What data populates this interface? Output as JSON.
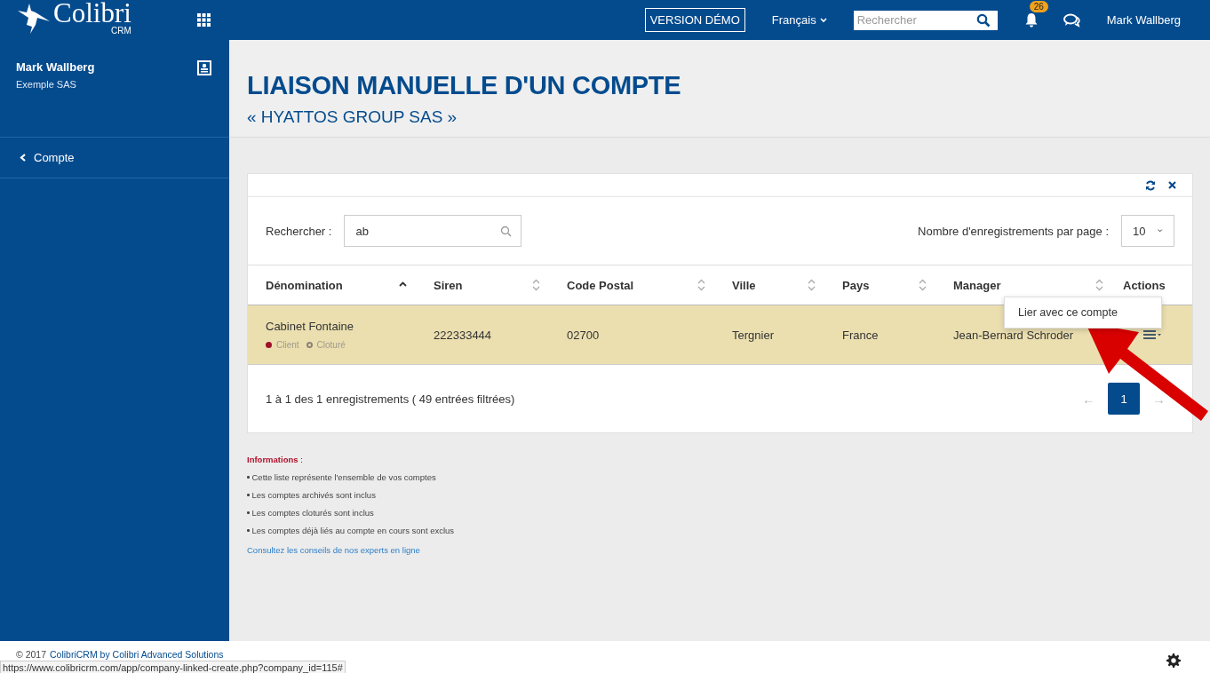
{
  "header": {
    "logo": "Colibri",
    "logo_sub": "CRM",
    "demo_button": "VERSION DÉMO",
    "language": "Français",
    "search": {
      "placeholder": "Rechercher"
    },
    "notifications": "26",
    "user": "Mark Wallberg"
  },
  "sidebar": {
    "user_name": "Mark Wallberg",
    "company": "Exemple SAS",
    "items": [
      {
        "label": "Compte"
      }
    ]
  },
  "page": {
    "title": "LIAISON MANUELLE D'UN COMPTE",
    "subtitle": "« HYATTOS GROUP SAS »"
  },
  "table_panel": {
    "search_label": "Rechercher :",
    "search_value": "ab",
    "page_size_label": "Nombre d'enregistrements par page :",
    "page_size": "10",
    "columns": [
      {
        "label": "Dénomination",
        "sortable": true,
        "sorted": true
      },
      {
        "label": "Siren",
        "sortable": true,
        "sorted": false
      },
      {
        "label": "Code Postal",
        "sortable": true,
        "sorted": false
      },
      {
        "label": "Ville",
        "sortable": true,
        "sorted": false
      },
      {
        "label": "Pays",
        "sortable": true,
        "sorted": false
      },
      {
        "label": "Manager",
        "sortable": true,
        "sorted": false
      },
      {
        "label": "Actions"
      }
    ],
    "rows": [
      {
        "selected": true,
        "tags": [
          {
            "label": "Client",
            "color": "#a0102a",
            "filled": true
          },
          {
            "label": "Cloturé",
            "color": "#8c8276",
            "filled": false
          }
        ],
        "cells": [
          "Cabinet Fontaine",
          "222333444",
          "02700",
          "Tergnier",
          "France",
          "Jean-Bernard Schroder"
        ]
      }
    ],
    "menu": {
      "items": [
        "Lier avec ce compte"
      ]
    },
    "summary": "1 à 1 des 1 enregistrements ( 49 entrées filtrées)",
    "prev": "←",
    "next": "→",
    "pages": [
      {
        "label": "1",
        "selected": true
      }
    ]
  },
  "info": {
    "title": "Informations",
    "colon": ":",
    "items": [
      "Cette liste représente l'ensemble de vos comptes",
      "Les comptes archivés sont inclus",
      "Les comptes cloturés sont inclus",
      "Les comptes déjà liés au compte en cours sont exclus"
    ],
    "link": "Consultez les conseils de nos experts en ligne"
  },
  "footer": {
    "copyright": "© 2017",
    "link": "ColibriCRM by Colibri Advanced Solutions"
  },
  "status_url": "https://www.colibricrm.com/app/company-linked-create.php?company_id=115#"
}
